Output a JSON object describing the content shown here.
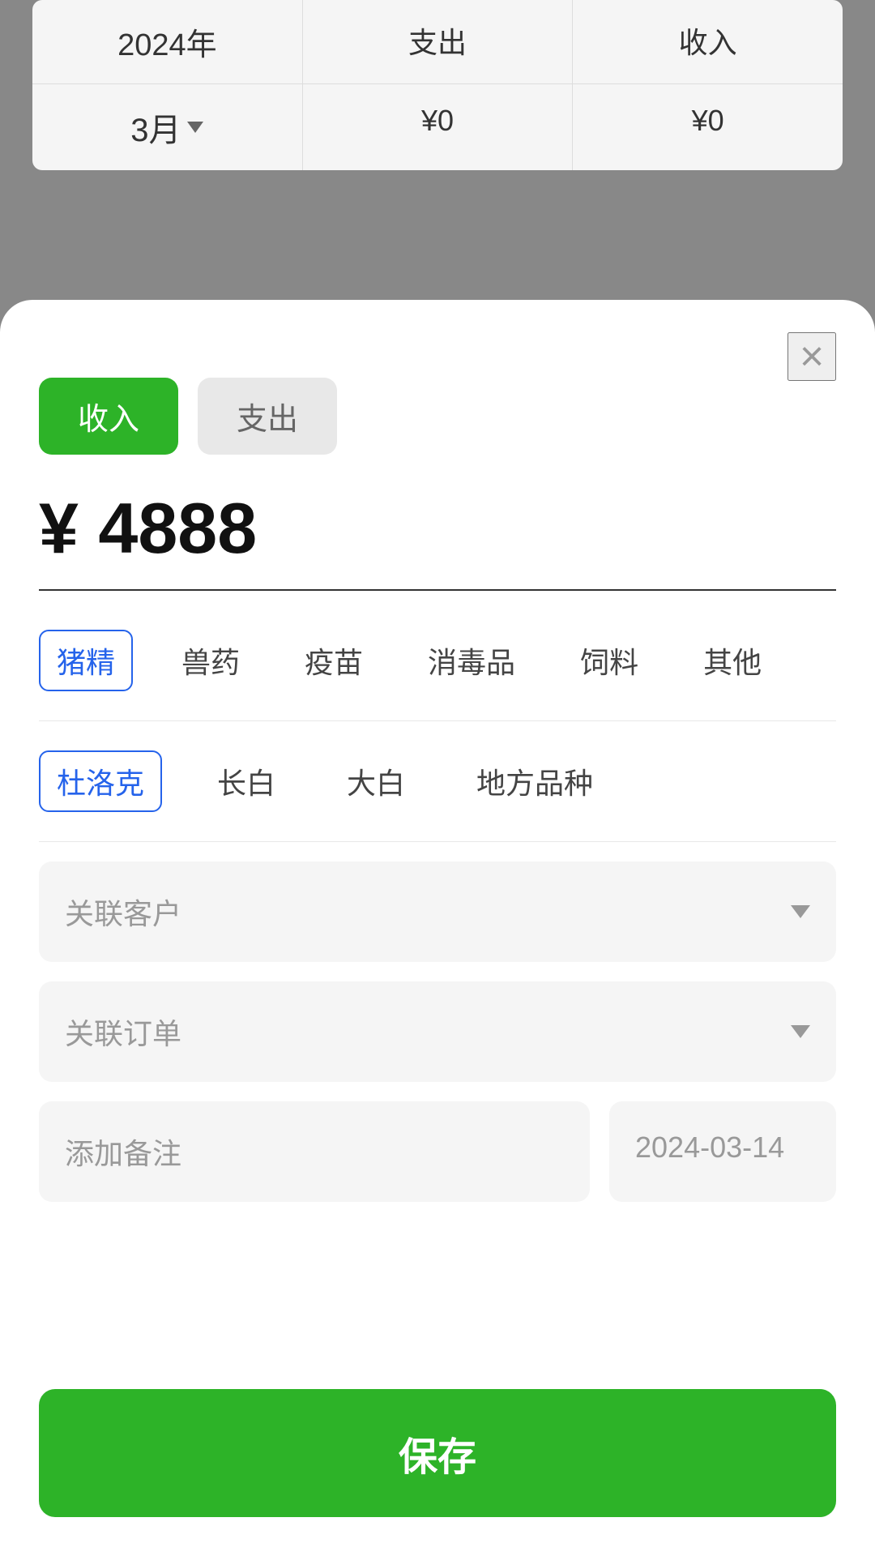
{
  "background": {
    "table": {
      "header": {
        "col1": "2024年",
        "col2": "支出",
        "col3": "收入"
      },
      "row": {
        "col1": "3月",
        "col2": "¥0",
        "col3": "¥0"
      }
    }
  },
  "modal": {
    "close_label": "×",
    "toggle": {
      "income_label": "收入",
      "expense_label": "支出"
    },
    "amount": "¥ 4888",
    "categories": [
      {
        "id": "pig",
        "label": "猪精",
        "selected": true
      },
      {
        "id": "vet",
        "label": "兽药",
        "selected": false
      },
      {
        "id": "vaccine",
        "label": "疫苗",
        "selected": false
      },
      {
        "id": "disinfect",
        "label": "消毒品",
        "selected": false
      },
      {
        "id": "feed",
        "label": "饲料",
        "selected": false
      },
      {
        "id": "other",
        "label": "其他",
        "selected": false
      }
    ],
    "subcategories": [
      {
        "id": "duroc",
        "label": "杜洛克",
        "selected": true
      },
      {
        "id": "landrace",
        "label": "长白",
        "selected": false
      },
      {
        "id": "yorkshire",
        "label": "大白",
        "selected": false
      },
      {
        "id": "local",
        "label": "地方品种",
        "selected": false
      }
    ],
    "customer_dropdown": {
      "placeholder": "关联客户",
      "value": ""
    },
    "order_dropdown": {
      "placeholder": "关联订单",
      "value": ""
    },
    "note_field": {
      "placeholder": "添加备注"
    },
    "date_field": {
      "value": "2024-03-14"
    },
    "save_button": "保存"
  }
}
